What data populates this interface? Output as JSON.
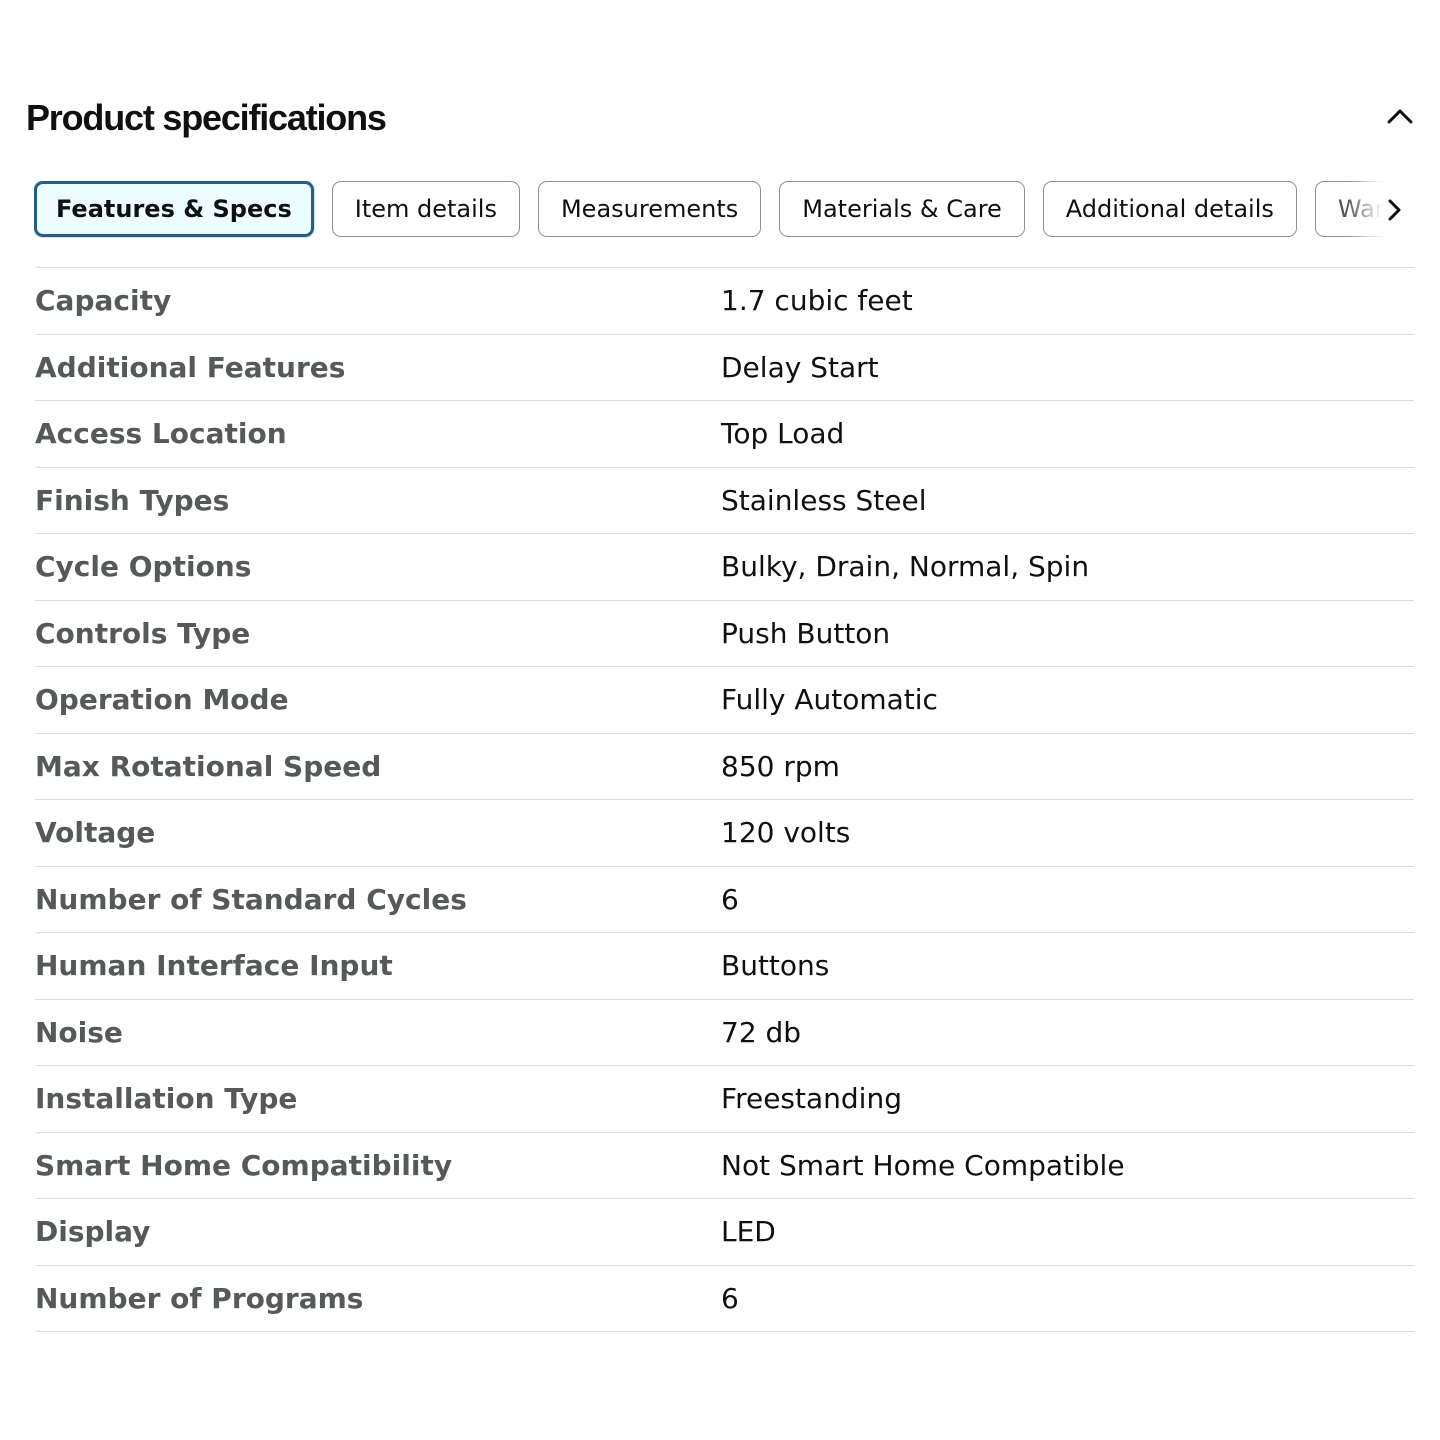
{
  "section": {
    "title": "Product specifications",
    "collapse_icon": "chevron-up-icon"
  },
  "tabs": [
    {
      "label": "Features & Specs",
      "active": true
    },
    {
      "label": "Item details",
      "active": false
    },
    {
      "label": "Measurements",
      "active": false
    },
    {
      "label": "Materials & Care",
      "active": false
    },
    {
      "label": "Additional details",
      "active": false
    },
    {
      "label": "Warra",
      "active": false
    }
  ],
  "tabs_scroll_icon": "chevron-right-icon",
  "specs": [
    {
      "label": "Capacity",
      "value": "1.7 cubic feet"
    },
    {
      "label": "Additional Features",
      "value": "Delay Start"
    },
    {
      "label": "Access Location",
      "value": "Top Load"
    },
    {
      "label": "Finish Types",
      "value": "Stainless Steel"
    },
    {
      "label": "Cycle Options",
      "value": "Bulky, Drain, Normal, Spin"
    },
    {
      "label": "Controls Type",
      "value": "Push Button"
    },
    {
      "label": "Operation Mode",
      "value": "Fully Automatic"
    },
    {
      "label": "Max Rotational Speed",
      "value": "850 rpm"
    },
    {
      "label": "Voltage",
      "value": "120 volts"
    },
    {
      "label": "Number of Standard Cycles",
      "value": "6"
    },
    {
      "label": "Human Interface Input",
      "value": "Buttons"
    },
    {
      "label": "Noise",
      "value": "72 db"
    },
    {
      "label": "Installation Type",
      "value": "Freestanding"
    },
    {
      "label": "Smart Home Compatibility",
      "value": "Not Smart Home Compatible"
    },
    {
      "label": "Display",
      "value": "LED"
    },
    {
      "label": "Number of Programs",
      "value": "6"
    }
  ],
  "colors": {
    "active_tab_border": "#2a5b84",
    "active_tab_bg": "#edfdff",
    "label_text": "#565959",
    "value_text": "#0f1111",
    "divider": "#dddddd"
  }
}
